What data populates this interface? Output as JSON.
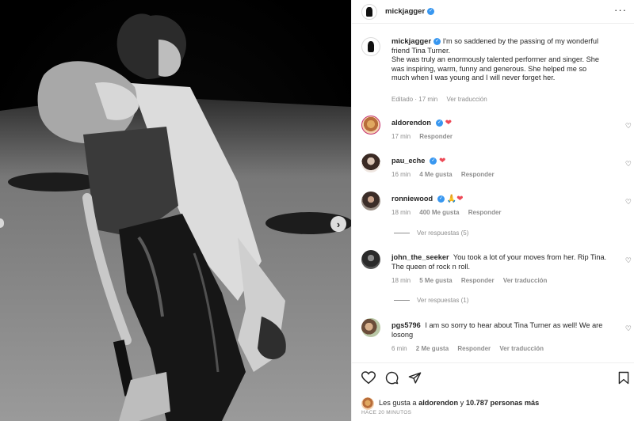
{
  "post": {
    "author": "mickjagger",
    "more_icon": "more-horizontal-icon",
    "caption_lines": [
      "I'm so saddened by the passing of my wonderful",
      "friend Tina Turner.",
      "She was truly an enormously talented performer and singer. She",
      "was inspiring, warm, funny and generous. She helped me so",
      "much when I was young and I will never forget her."
    ],
    "caption_meta": {
      "edited": "Editado · 17 min",
      "translate": "Ver traducción"
    }
  },
  "comments": [
    {
      "user": "aldorendon",
      "verified": true,
      "text": "",
      "emoji": "❤",
      "time": "17 min",
      "likes": "",
      "reply": "Responder",
      "translate": ""
    },
    {
      "user": "pau_eche",
      "verified": true,
      "text": "",
      "emoji": "❤",
      "time": "16 min",
      "likes": "4 Me gusta",
      "reply": "Responder",
      "translate": ""
    },
    {
      "user": "ronniewood",
      "verified": true,
      "text": "",
      "emoji": "🙏❤",
      "time": "18 min",
      "likes": "400 Me gusta",
      "reply": "Responder",
      "translate": "",
      "view_replies": "Ver respuestas (5)"
    },
    {
      "user": "john_the_seeker",
      "verified": false,
      "text": "You took a lot of your moves from her. Rip Tina. The queen of rock n roll.",
      "emoji": "",
      "time": "18 min",
      "likes": "5 Me gusta",
      "reply": "Responder",
      "translate": "Ver traducción",
      "view_replies": "Ver respuestas (1)"
    },
    {
      "user": "pgs5796",
      "verified": false,
      "text": "I am so sorry to hear about Tina Turner as well! We are losong",
      "emoji": "",
      "time": "6 min",
      "likes": "2 Me gusta",
      "reply": "Responder",
      "translate": "Ver traducción"
    }
  ],
  "footer": {
    "likes_prefix": "Les gusta a",
    "likes_user": "aldorendon",
    "likes_mid": "y",
    "likes_count": "10.787 personas más",
    "time_ago": "HACE 20 MINUTOS"
  },
  "icons": {
    "like": "heart-icon",
    "comment": "comment-icon",
    "share": "share-icon",
    "save": "bookmark-icon",
    "carousel_next": "chevron-right-icon"
  },
  "colors": {
    "verified": "#3897f0",
    "heart": "#ed4956",
    "muted": "#8e8e8e"
  }
}
